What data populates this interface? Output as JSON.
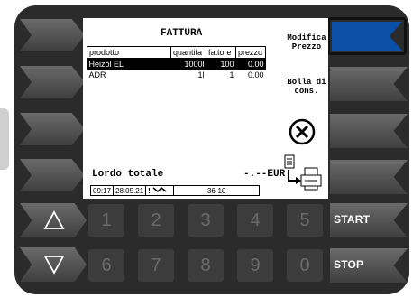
{
  "screen": {
    "title": "FATTURA",
    "table": {
      "headers": [
        "prodotto",
        "quantita",
        "fattore",
        "prezzo"
      ],
      "rows": [
        {
          "prodotto": "Heizöl EL",
          "quantita": "1000l",
          "fattore": "100",
          "prezzo": "0.00",
          "selected": true
        },
        {
          "prodotto": "ADR",
          "quantita": "1l",
          "fattore": "1",
          "prezzo": "0.00",
          "selected": false
        }
      ]
    },
    "side": {
      "modifica_line1": "Modifica",
      "modifica_line2": "Prezzo",
      "bolla_line1": "Bolla di",
      "bolla_line2": "cons."
    },
    "total": {
      "label": "Lordo totale",
      "value": "-.--EUR"
    },
    "status": {
      "time": "09:17",
      "date": "28.05.21",
      "icon_text": "!",
      "code": "36-10"
    }
  },
  "keypad": {
    "row1": [
      "1",
      "2",
      "3",
      "4",
      "5"
    ],
    "row2": [
      "6",
      "7",
      "8",
      "9",
      "0"
    ]
  },
  "right_keys": {
    "start": "START",
    "stop": "STOP"
  },
  "colors": {
    "active_key": "#0c4fa8",
    "bezel": "#2b2b2b"
  }
}
